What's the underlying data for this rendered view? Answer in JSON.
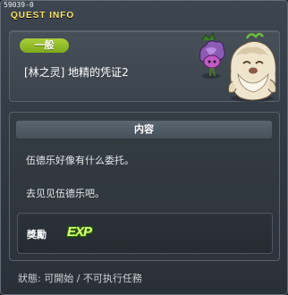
{
  "window": {
    "quest_id": "59039-0",
    "title": "QUEST INFO"
  },
  "header": {
    "category_badge": "一般",
    "quest_name": "[林之灵] 地精的凭证2",
    "npc_icon": "npc-portrait-icon"
  },
  "content": {
    "heading": "内容",
    "lines": [
      "伍德乐好像有什么委托。",
      "去见见伍德乐吧。"
    ],
    "reward": {
      "label": "獎勵",
      "exp_label": "EXP"
    }
  },
  "status": {
    "text": "狀態: 可開始 / 不可执行任務"
  },
  "colors": {
    "title_yellow": "#ffe46a",
    "badge_green": "#98c22b",
    "exp_green": "#dfff70"
  }
}
